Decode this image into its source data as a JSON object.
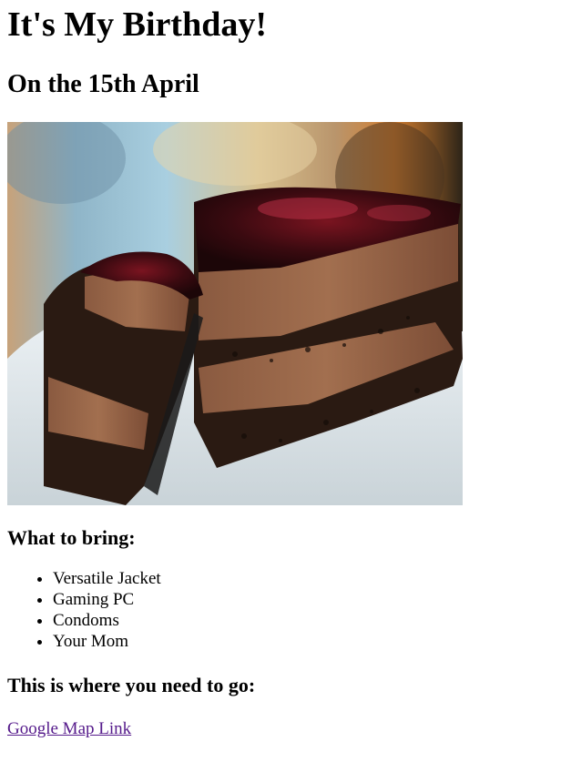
{
  "page": {
    "title": "It's My Birthday!",
    "subtitle": "On the 15th April"
  },
  "image": {
    "description_icon": "cake-photo"
  },
  "bring": {
    "heading": "What to bring:",
    "items": [
      "Versatile Jacket",
      "Gaming PC",
      "Condoms",
      "Your Mom"
    ]
  },
  "location": {
    "heading": "This is where you need to go:",
    "link_label": "Google Map Link"
  },
  "colors": {
    "link": "#551a8b",
    "text": "#000000",
    "background": "#ffffff"
  }
}
